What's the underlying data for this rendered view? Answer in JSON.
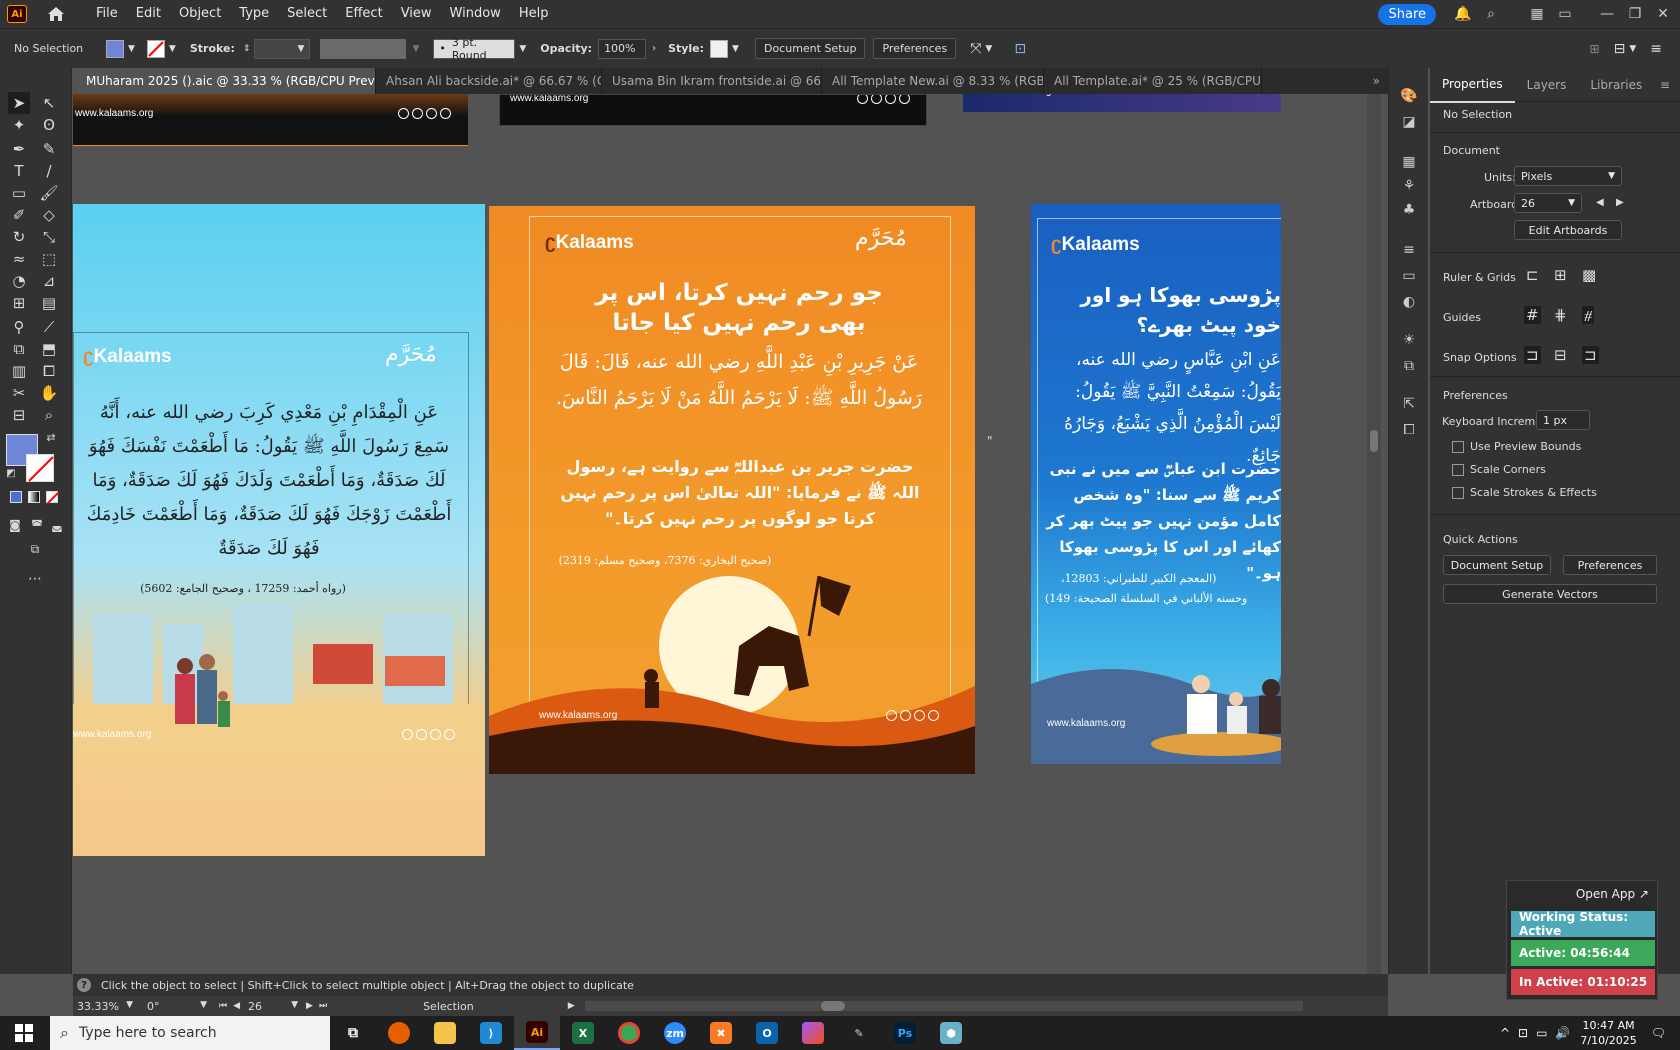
{
  "menubar": {
    "logo": "Ai",
    "items": [
      "File",
      "Edit",
      "Object",
      "Type",
      "Select",
      "Effect",
      "View",
      "Window",
      "Help"
    ],
    "share": "Share"
  },
  "control": {
    "selection": "No Selection",
    "stroke_label": "Stroke:",
    "brush": "3 pt. Round",
    "opacity_label": "Opacity:",
    "opacity_value": "100%",
    "style_label": "Style:",
    "document_setup": "Document Setup",
    "preferences": "Preferences"
  },
  "tabs": [
    {
      "label": "MUharam 2025 ().aic @ 33.33 % (RGB/CPU Preview)",
      "active": true
    },
    {
      "label": "Ahsan Ali backside.ai* @ 66.67 % (C...",
      "active": false
    },
    {
      "label": "Usama Bin Ikram frontside.ai @ 66.6...",
      "active": false
    },
    {
      "label": "All Template New.ai @ 8.33 % (RGB/...",
      "active": false
    },
    {
      "label": "All Template.ai* @ 25 % (RGB/CPU P...",
      "active": false
    }
  ],
  "panel": {
    "tabs": [
      "Properties",
      "Layers",
      "Libraries"
    ],
    "selection": "No Selection",
    "document_header": "Document",
    "units_label": "Units:",
    "units_value": "Pixels",
    "artboard_label": "Artboard:",
    "artboard_value": "26",
    "edit_artboards": "Edit Artboards",
    "ruler_grids": "Ruler & Grids",
    "guides": "Guides",
    "snap_options": "Snap Options",
    "preferences_header": "Preferences",
    "keyboard_increment_label": "Keyboard Increment:",
    "keyboard_increment_value": "1 px",
    "use_preview_bounds": "Use Preview Bounds",
    "scale_corners": "Scale Corners",
    "scale_strokes": "Scale Strokes & Effects",
    "quick_actions": "Quick Actions",
    "qa_document_setup": "Document Setup",
    "qa_preferences": "Preferences",
    "generate_vectors": "Generate Vectors"
  },
  "statusline": "Click the object to select  |  Shift+Click to select multiple object  |  Alt+Drag the object to duplicate",
  "bottombar": {
    "zoom": "33.33%",
    "rotation": "0°",
    "artboard": "26",
    "tool": "Selection"
  },
  "work": {
    "open_app": "Open App ↗",
    "status": "Working Status: Active",
    "active": "Active: 04:56:44",
    "inactive": "In Active: 01:10:25"
  },
  "taskbar": {
    "search": "Type here to search",
    "time": "10:47 AM",
    "date": "7/10/2025"
  },
  "artboards": {
    "site": "www.kalaams.org",
    "brand": "Kalaams",
    "muharram": "مُحَرَّم",
    "left": {
      "arabic": "عَنِ الْمِقْدَامِ بْنِ مَعْدِي كَرِبَ رضي الله عنه، أَنَّهُ سَمِعَ رَسُولَ اللَّهِ ﷺ يَقُولُ: مَا أَطْعَمْتَ نَفْسَكَ فَهُوَ لَكَ صَدَقَةٌ، وَمَا أَطْعَمْتَ وَلَدَكَ فَهُوَ لَكَ صَدَقَةٌ، وَمَا أَطْعَمْتَ زَوْجَكَ فَهُوَ لَكَ صَدَقَةٌ، وَمَا أَطْعَمْتَ خَادِمَكَ فَهُوَ لَكَ صَدَقَةٌ",
      "ref": "(رواه أحمد: 17259 ، وصحيح الجامع: 5602)"
    },
    "middle": {
      "title": "جو رحم نہیں کرتا، اس پر بھی رحم نہیں کیا جاتا",
      "arabic": "عَنْ جَرِيرِ بْنِ عَبْدِ اللَّهِ رضي الله عنه، قَالَ: قَالَ رَسُولُ اللَّهِ ﷺ: لَا يَرْحَمُ اللَّهُ مَنْ لَا يَرْحَمُ النَّاسَ.",
      "urdu": "حضرت جریر بن عبداللہؓ سے روایت ہے، رسول اللہ ﷺ نے فرمایا: \"اللہ تعالیٰ اس پر رحم نہیں کرتا جو لوگوں پر رحم نہیں کرتا۔\"",
      "ref": "(صحیح البخاري: 7376، وصحیح مسلم: 2319)"
    },
    "right": {
      "title": "پڑوسی بھوکا ہو اور خود پیٹ بھرے؟",
      "arabic": "عَنِ ابْنِ عَبَّاسٍ رضي الله عنه، يَقُولُ: سَمِعْتُ النَّبِيَّ ﷺ يَقُولُ: لَيْسَ الْمُؤْمِنُ الَّذِي يَشْبَعُ، وَجَارُهُ جَائِعٌ.",
      "urdu": "حضرت ابن عباسؓ سے میں نے نبی کریم ﷺ سے سنا: \"وہ شخص کامل مؤمن نہیں جو پیٹ بھر کر کھائے اور اس کا پڑوسی بھوکا ہو۔\"",
      "ref1": "(المعجم الكبير للطبراني: 12803،",
      "ref2": "وحسنه الألباني في السلسلة الصحيحة: 149)"
    }
  },
  "colors": {
    "accent": "#1473e6",
    "orange": "#f08a24",
    "sky": "#5ad0f0",
    "blue": "#1a5fc0",
    "fill_swatch": "#6f86d6"
  }
}
